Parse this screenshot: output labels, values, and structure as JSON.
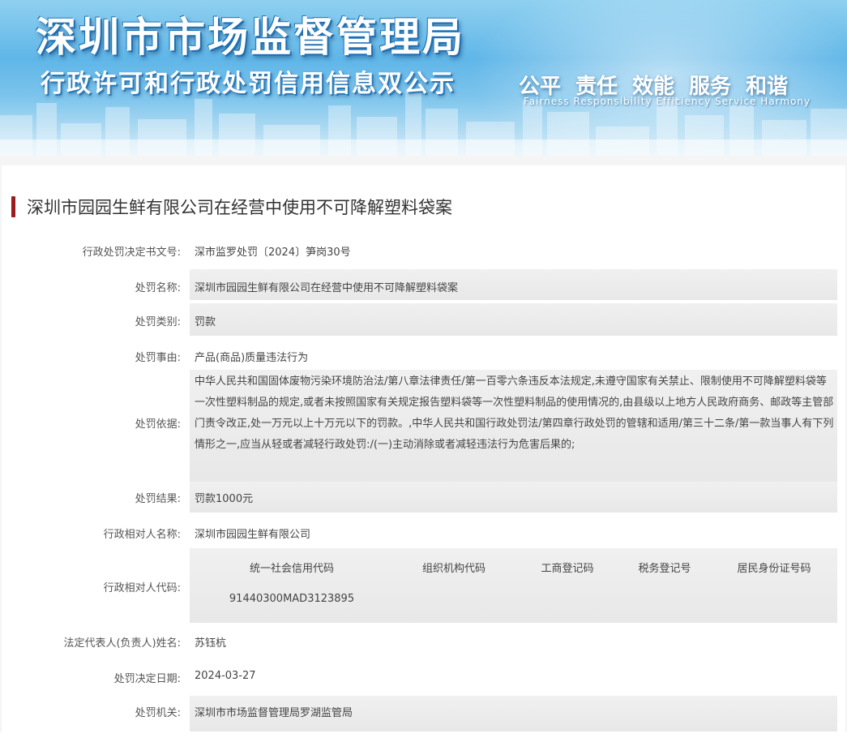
{
  "header": {
    "title": "深圳市市场监督管理局",
    "subtitle": "行政许可和行政处罚信用信息双公示",
    "slogans": [
      "公平",
      "责任",
      "效能",
      "服务",
      "和谐"
    ],
    "slogan_en": "Fairness  Responsibility  Efficiency  Service  Harmony"
  },
  "case": {
    "title": "深圳市园园生鲜有限公司在经营中使用不可降解塑料袋案",
    "fields": {
      "doc_no_label": "行政处罚决定书文号:",
      "doc_no": "深市监罗处罚〔2024〕笋岗30号",
      "name_label": "处罚名称:",
      "name": "深圳市园园生鲜有限公司在经营中使用不可降解塑料袋案",
      "category_label": "处罚类别:",
      "category": "罚款",
      "reason_label": "处罚事由:",
      "reason": "产品(商品)质量违法行为",
      "basis_label": "处罚依据:",
      "basis": "中华人民共和国固体废物污染环境防治法/第八章法律责任/第一百零六条违反本法规定,未遵守国家有关禁止、限制使用不可降解塑料袋等一次性塑料制品的规定,或者未按照国家有关规定报告塑料袋等一次性塑料制品的使用情况的,由县级以上地方人民政府商务、邮政等主管部门责令改正,处一万元以上十万元以下的罚款。,中华人民共和国行政处罚法/第四章行政处罚的管辖和适用/第三十二条/第一款当事人有下列情形之一,应当从轻或者减轻行政处罚:/(一)主动消除或者减轻违法行为危害后果的;",
      "result_label": "处罚结果:",
      "result": "罚款1000元",
      "party_label": "行政相对人名称:",
      "party": "深圳市园园生鲜有限公司",
      "party_code_label": "行政相对人代码:",
      "code_headers": [
        "统一社会信用代码",
        "组织机构代码",
        "工商登记码",
        "税务登记号",
        "居民身份证号码"
      ],
      "code_values": [
        "91440300MAD3123895",
        "",
        "",
        "",
        ""
      ],
      "legal_rep_label": "法定代表人(负责人)姓名:",
      "legal_rep": "苏钰杭",
      "date_label": "处罚决定日期:",
      "date": "2024-03-27",
      "authority_label": "处罚机关:",
      "authority": "深圳市市场监督管理局罗湖监管局"
    }
  },
  "colors": {
    "accent": "#9b1c1c",
    "banner_blue": "#5fb6e8",
    "row_shade": "#ececec"
  }
}
